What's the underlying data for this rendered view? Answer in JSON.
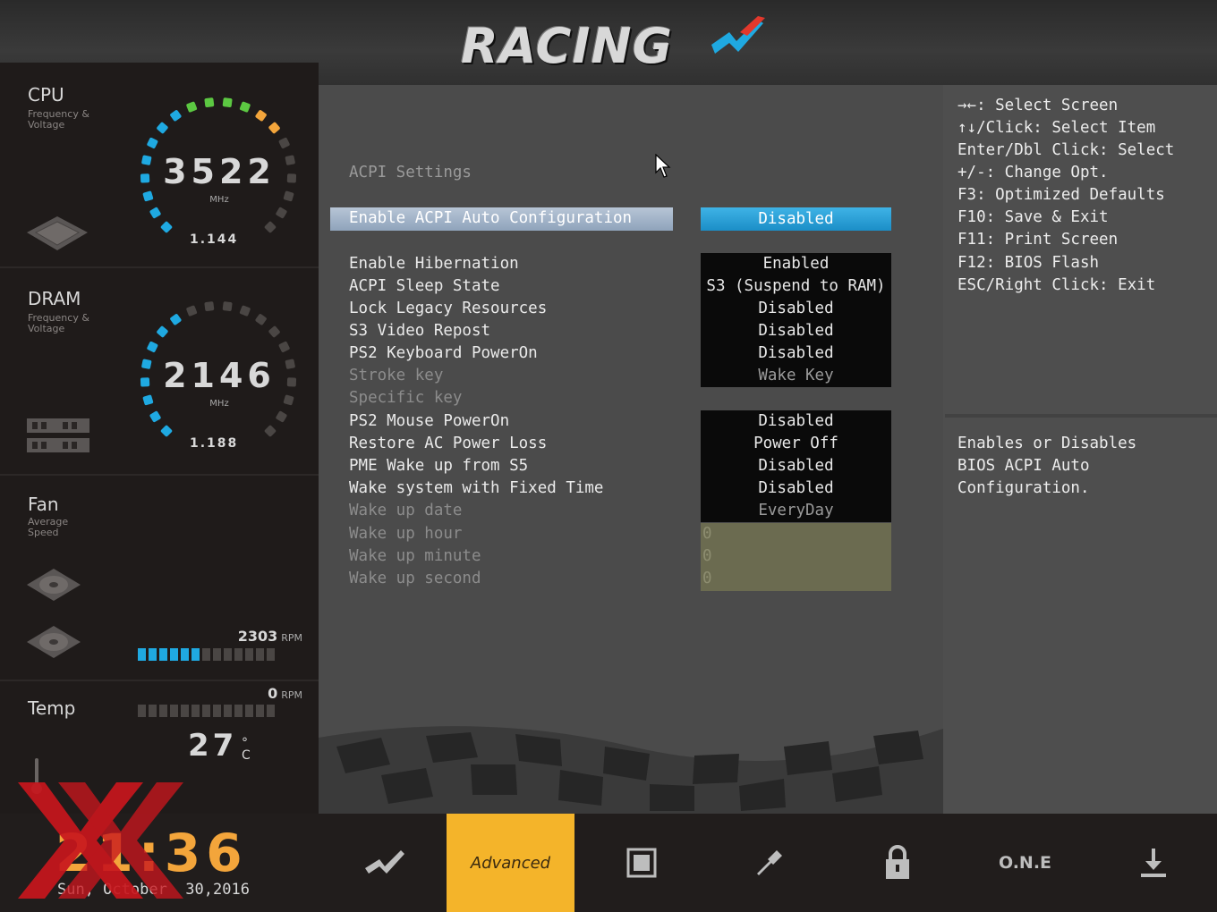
{
  "header": {
    "logo_text": "RACING"
  },
  "sidebar": {
    "cpu": {
      "title": "CPU",
      "subtitle_line1": "Frequency &",
      "subtitle_line2": "Voltage",
      "value": "3522",
      "unit": "MHz",
      "voltage": "1.144"
    },
    "dram": {
      "title": "DRAM",
      "subtitle_line1": "Frequency &",
      "subtitle_line2": "Voltage",
      "value": "2146",
      "unit": "MHz",
      "voltage": "1.188"
    },
    "fan": {
      "title": "Fan",
      "subtitle_line1": "Average",
      "subtitle_line2": "Speed",
      "fan1_value": "2303",
      "fan1_unit": "RPM",
      "fan1_level": 0.45,
      "fan2_value": "0",
      "fan2_unit": "RPM",
      "fan2_level": 0
    },
    "temp": {
      "title": "Temp",
      "value": "27",
      "unit": "°C"
    }
  },
  "main": {
    "section_title": "ACPI Settings",
    "selected": {
      "label": "Enable ACPI Auto Configuration",
      "value": "Disabled"
    },
    "settings": [
      {
        "label": "Enable Hibernation",
        "value": "Enabled"
      },
      {
        "label": "ACPI Sleep State",
        "value": "S3 (Suspend to RAM)"
      },
      {
        "label": "Lock Legacy Resources",
        "value": "Disabled"
      },
      {
        "label": "S3 Video Repost",
        "value": "Disabled"
      },
      {
        "label": "PS2 Keyboard PowerOn",
        "value": "Disabled"
      },
      {
        "label": "Stroke key",
        "value": "Wake Key"
      },
      {
        "label": "Specific key",
        "value": ""
      },
      {
        "label": "PS2 Mouse PowerOn",
        "value": "Disabled"
      },
      {
        "label": "Restore AC Power Loss",
        "value": "Power Off"
      },
      {
        "label": "PME Wake up from S5",
        "value": "Disabled"
      },
      {
        "label": "Wake system with Fixed Time",
        "value": "Disabled"
      },
      {
        "label": "Wake up date",
        "value": "EveryDay"
      },
      {
        "label": "Wake up hour",
        "value": "0"
      },
      {
        "label": "Wake up minute",
        "value": "0"
      },
      {
        "label": "Wake up second",
        "value": "0"
      }
    ]
  },
  "help": {
    "keys": [
      "→←: Select Screen",
      "↑↓/Click: Select Item",
      "Enter/Dbl Click: Select",
      "+/-: Change Opt.",
      "F3: Optimized Defaults",
      "F10: Save & Exit",
      "F11: Print Screen",
      "F12: BIOS Flash",
      "ESC/Right Click: Exit"
    ],
    "description": [
      "Enables or Disables",
      "BIOS ACPI Auto",
      "Configuration."
    ]
  },
  "footer": {
    "time": "21:36",
    "date": "Sun, October  30,2016",
    "tabs": [
      {
        "icon": "racing-logo-icon"
      },
      {
        "label": "Advanced",
        "active": true
      },
      {
        "icon": "chipset-icon"
      },
      {
        "icon": "tools-icon"
      },
      {
        "icon": "lock-icon"
      },
      {
        "label": "O.N.E"
      },
      {
        "icon": "download-icon"
      }
    ]
  },
  "colors": {
    "accent_orange": "#f4b42a",
    "gauge_blue": "#1fa9e1",
    "selected_value_blue": "#1b8ec7",
    "watermark_red": "#c8161d"
  }
}
